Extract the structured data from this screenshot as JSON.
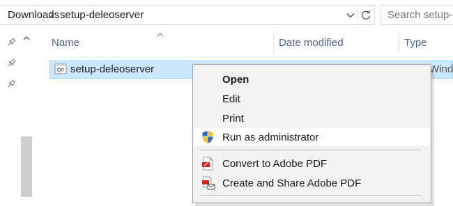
{
  "address_bar": {
    "breadcrumbs": [
      "Downloads",
      "setup-deleoserver"
    ],
    "separator_icon": "chevron-right-icon",
    "dropdown_icon": "chevron-down-icon",
    "refresh_icon": "refresh-icon"
  },
  "search": {
    "placeholder": "Search setup-deleoserver"
  },
  "nav_pane": {
    "pins": [
      "pin-icon",
      "pin-icon",
      "pin-icon"
    ]
  },
  "columns": {
    "name": "Name",
    "date_modified": "Date modified",
    "type": "Type"
  },
  "file": {
    "name": "setup-deleoserver",
    "type": "Windows Batch File",
    "icon": "batch-file-icon"
  },
  "context_menu": {
    "items": [
      {
        "label": "Open"
      },
      {
        "label": "Edit"
      },
      {
        "label": "Print"
      },
      {
        "label": "Run as administrator",
        "icon": "uac-shield-icon"
      },
      {
        "label": "Convert to Adobe PDF",
        "icon": "adobe-pdf-icon"
      },
      {
        "label": "Create and Share Adobe PDF",
        "icon": "adobe-pdf-share-icon"
      }
    ]
  },
  "colors": {
    "selection_bg": "#cce8ff",
    "selection_border": "#99d1ff",
    "menu_bg": "#f2f2f2",
    "column_header_text": "#4d6082"
  }
}
